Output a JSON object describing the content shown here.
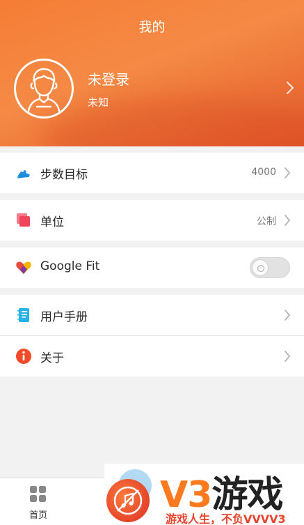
{
  "header": {
    "title": "我的",
    "username": "未登录",
    "gender": "未知"
  },
  "menu": {
    "step_goal": {
      "label": "步数目标",
      "value": "4000",
      "icon": "sneaker-icon"
    },
    "unit": {
      "label": "单位",
      "value": "公制",
      "icon": "layers-icon"
    },
    "google_fit": {
      "label": "Google Fit",
      "enabled": false,
      "icon": "google-fit-heart-icon"
    },
    "manual": {
      "label": "用户手册",
      "icon": "notebook-icon"
    },
    "about": {
      "label": "关于",
      "icon": "info-icon"
    }
  },
  "bottom_nav": {
    "home_label": "首页"
  },
  "watermark": {
    "brand_v3": "V3",
    "brand_cn": "游戏",
    "slogan": "游戏人生，不负VVVV3"
  },
  "colors": {
    "header_orange": "#f57d35",
    "accent_blue": "#1e8fe0",
    "accent_pink": "#f0455a",
    "accent_red": "#f04a2a",
    "watermark_orange": "#ff7a1e"
  }
}
